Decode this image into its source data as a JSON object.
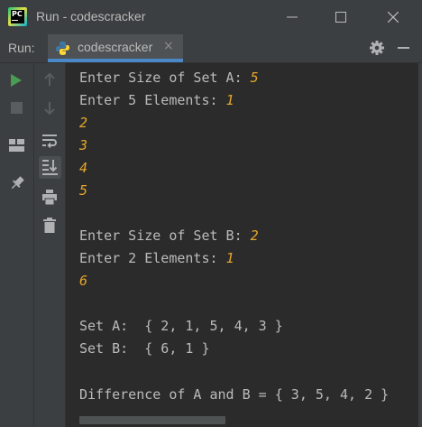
{
  "window": {
    "title": "Run - codescracker"
  },
  "toolwindow": {
    "label": "Run:",
    "tab_label": "codescracker",
    "tab_close": "×"
  },
  "console": {
    "lines": [
      {
        "prompt": "Enter Size of Set A: ",
        "input": "5"
      },
      {
        "prompt": "Enter 5 Elements: ",
        "input": "1"
      },
      {
        "prompt": "",
        "input": "2"
      },
      {
        "prompt": "",
        "input": "3"
      },
      {
        "prompt": "",
        "input": "4"
      },
      {
        "prompt": "",
        "input": "5"
      },
      {
        "prompt": "Enter Size of Set B: ",
        "input": "2"
      },
      {
        "prompt": "Enter 2 Elements: ",
        "input": "1"
      },
      {
        "prompt": "",
        "input": "6"
      },
      {
        "prompt": "Set A:  { 2, 1, 5, 4, 3 }",
        "input": ""
      },
      {
        "prompt": "Set B:  { 6, 1 }",
        "input": ""
      },
      {
        "prompt": "Difference of A and B = { 3, 5, 4, 2 }",
        "input": ""
      }
    ]
  },
  "colors": {
    "input_text": "#e5a62b",
    "output_text": "#bbbbbb",
    "tab_underline": "#4a88c7",
    "run_green": "#499c54"
  },
  "icons": [
    "pycharm-app-icon",
    "minimize-window-icon",
    "maximize-window-icon",
    "close-window-icon",
    "python-file-icon",
    "gear-icon",
    "hide-panel-icon",
    "rerun-icon",
    "stop-icon",
    "layout-icon",
    "pin-icon",
    "scroll-up-icon",
    "scroll-down-icon",
    "soft-wrap-icon",
    "scroll-to-end-icon",
    "print-icon",
    "clear-all-icon"
  ]
}
